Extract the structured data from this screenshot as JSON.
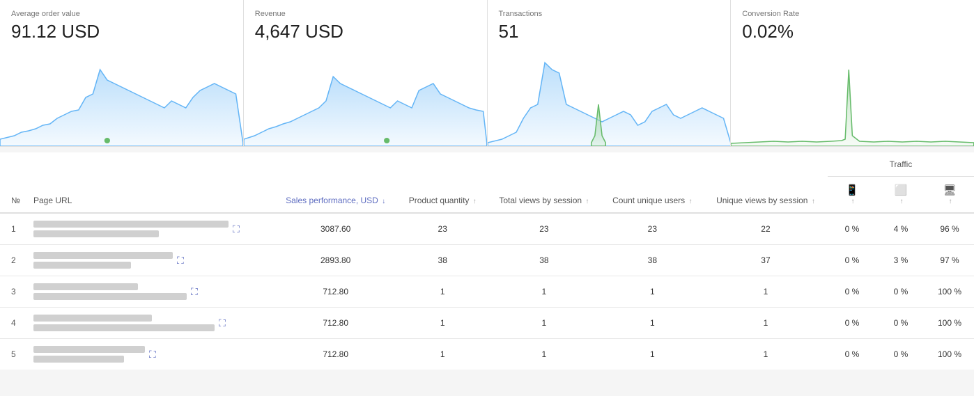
{
  "metrics": [
    {
      "label": "Average order value",
      "value": "91.12 USD",
      "chartColor": "#90caf9",
      "hasGreen": true
    },
    {
      "label": "Revenue",
      "value": "4,647 USD",
      "chartColor": "#90caf9",
      "hasGreen": true
    },
    {
      "label": "Transactions",
      "value": "51",
      "chartColor": "#90caf9",
      "hasGreen": true
    },
    {
      "label": "Conversion Rate",
      "value": "0.02%",
      "chartColor": "#a5d6a7",
      "hasGreen": true
    }
  ],
  "table": {
    "headers": {
      "num": "№",
      "url": "Page URL",
      "sales": "Sales performance, USD",
      "product_qty": "Product quantity",
      "total_views": "Total views by session",
      "count_unique": "Count unique users",
      "unique_views": "Unique views by session",
      "traffic": "Traffic"
    },
    "traffic_sub": [
      "mobile",
      "tablet",
      "desktop"
    ],
    "rows": [
      {
        "num": 1,
        "bars": [
          280,
          180
        ],
        "sales": "3087.60",
        "product_qty": "23",
        "total_views": "23",
        "count_unique": "23",
        "unique_views": "22",
        "mobile": "0 %",
        "tablet": "4 %",
        "desktop": "96 %"
      },
      {
        "num": 2,
        "bars": [
          200,
          140
        ],
        "sales": "2893.80",
        "product_qty": "38",
        "total_views": "38",
        "count_unique": "38",
        "unique_views": "37",
        "mobile": "0 %",
        "tablet": "3 %",
        "desktop": "97 %"
      },
      {
        "num": 3,
        "bars": [
          150,
          220
        ],
        "sales": "712.80",
        "product_qty": "1",
        "total_views": "1",
        "count_unique": "1",
        "unique_views": "1",
        "mobile": "0 %",
        "tablet": "0 %",
        "desktop": "100 %"
      },
      {
        "num": 4,
        "bars": [
          170,
          260
        ],
        "sales": "712.80",
        "product_qty": "1",
        "total_views": "1",
        "count_unique": "1",
        "unique_views": "1",
        "mobile": "0 %",
        "tablet": "0 %",
        "desktop": "100 %"
      },
      {
        "num": 5,
        "bars": [
          160,
          130
        ],
        "sales": "712.80",
        "product_qty": "1",
        "total_views": "1",
        "count_unique": "1",
        "unique_views": "1",
        "mobile": "0 %",
        "tablet": "0 %",
        "desktop": "100 %"
      }
    ]
  }
}
